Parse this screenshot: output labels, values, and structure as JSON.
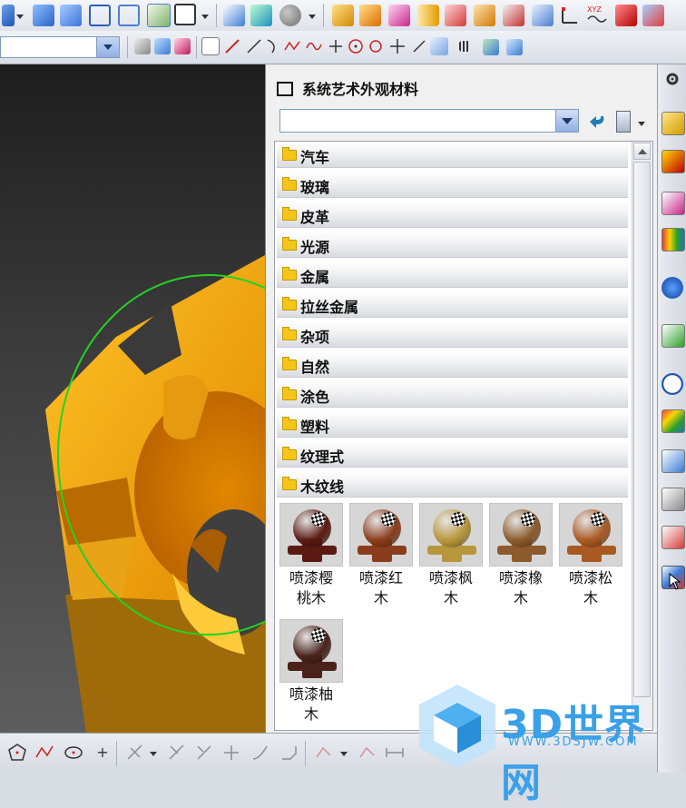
{
  "panel": {
    "title": "系统艺术外观材料",
    "filter_value": ""
  },
  "categories": [
    {
      "label": "汽车"
    },
    {
      "label": "玻璃"
    },
    {
      "label": "皮革"
    },
    {
      "label": "光源"
    },
    {
      "label": "金属"
    },
    {
      "label": "拉丝金属"
    },
    {
      "label": "杂项"
    },
    {
      "label": "自然"
    },
    {
      "label": "涂色"
    },
    {
      "label": "塑料"
    },
    {
      "label": "纹理式"
    },
    {
      "label": "木纹线"
    }
  ],
  "materials": [
    {
      "line1": "喷漆樱",
      "line2": "桃木",
      "color": "#5a1a12"
    },
    {
      "line1": "喷漆红",
      "line2": "木",
      "color": "#8a3d1c"
    },
    {
      "line1": "喷漆枫",
      "line2": "木",
      "color": "#b8973c"
    },
    {
      "line1": "喷漆橡",
      "line2": "木",
      "color": "#8d5a2c"
    },
    {
      "line1": "喷漆松",
      "line2": "木",
      "color": "#a85a22"
    },
    {
      "line1": "喷漆柚",
      "line2": "木",
      "color": "#4a221a"
    }
  ],
  "watermark": {
    "brand": "3D世界网",
    "url": "WWW.3DSJW.COM"
  },
  "colors": {
    "part": "#f7a90c",
    "outline": "#22d322",
    "accent": "#3aa0e8"
  }
}
